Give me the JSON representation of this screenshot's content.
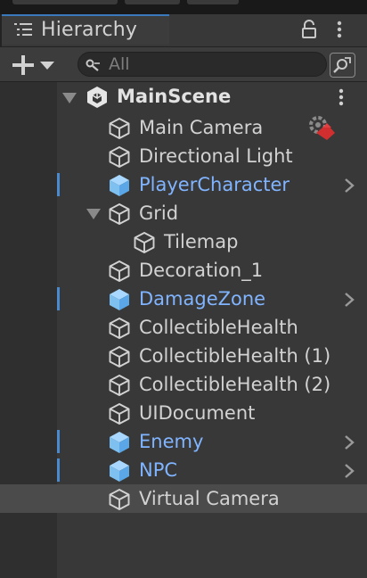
{
  "window": {
    "tab_label": "Hierarchy",
    "icons": [
      "hierarchy-list-icon",
      "lock-icon",
      "more-menu-icon"
    ]
  },
  "toolbar": {
    "add_icon": "plus-icon",
    "add_dropdown_icon": "caret-down-icon",
    "search": {
      "placeholder": "All",
      "value": "",
      "icon": "search-icon"
    },
    "search_mode_icon": "search-expand-icon"
  },
  "scene": {
    "name": "MainScene",
    "icon": "unity-scene-icon",
    "expanded": true,
    "menu_icon": "more-menu-icon"
  },
  "colors": {
    "background": "#383838",
    "panel": "#3c3c3c",
    "gutter": "#2f2f2f",
    "text": "#d2d2d2",
    "prefab_text": "#81b4ff",
    "prefab_marker": "#4a8ad0",
    "selected_row": "#4b4b4b",
    "tab_accent": "#3a79bb"
  },
  "hierarchy": [
    {
      "label": "Main Camera",
      "depth": 1,
      "prefab": false,
      "has_gizmo_icon": true
    },
    {
      "label": "Directional Light",
      "depth": 1,
      "prefab": false
    },
    {
      "label": "PlayerCharacter",
      "depth": 1,
      "prefab": true
    },
    {
      "label": "Grid",
      "depth": 1,
      "prefab": false,
      "expanded": true
    },
    {
      "label": "Tilemap",
      "depth": 2,
      "prefab": false
    },
    {
      "label": "Decoration_1",
      "depth": 1,
      "prefab": false
    },
    {
      "label": "DamageZone",
      "depth": 1,
      "prefab": true
    },
    {
      "label": "CollectibleHealth",
      "depth": 1,
      "prefab": false
    },
    {
      "label": "CollectibleHealth (1)",
      "depth": 1,
      "prefab": false
    },
    {
      "label": "CollectibleHealth (2)",
      "depth": 1,
      "prefab": false
    },
    {
      "label": "UIDocument",
      "depth": 1,
      "prefab": false
    },
    {
      "label": "Enemy",
      "depth": 1,
      "prefab": true
    },
    {
      "label": "NPC",
      "depth": 1,
      "prefab": true
    },
    {
      "label": "Virtual Camera",
      "depth": 1,
      "prefab": false,
      "selected": true
    }
  ]
}
